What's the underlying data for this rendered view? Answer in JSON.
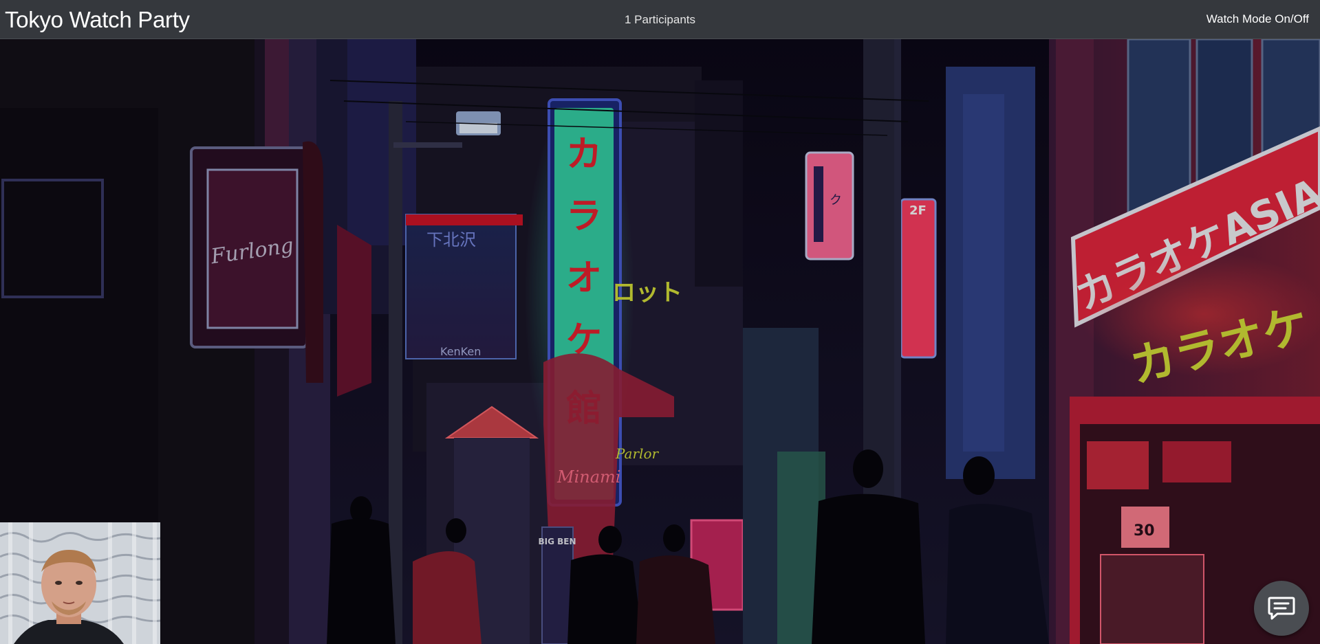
{
  "header": {
    "title": "Tokyo Watch Party",
    "participants": "1 Participants",
    "watch_mode_label": "Watch Mode On/Off"
  },
  "scene": {
    "vertical_sign": [
      "カ",
      "ラ",
      "オ",
      "ケ",
      "館"
    ],
    "right_sign_top": "カラオケASIA",
    "right_sign_bottom": "カラオケ",
    "pink_sign_left": "Furlong",
    "small_sign_text": "ロット",
    "parlor_text": "Parlor",
    "big_ben_text": "BIG BEN",
    "kenken_text": "KenKen"
  },
  "selfview": {
    "icon": "webcam-feed"
  },
  "chat": {
    "icon": "chat-bubble-icon"
  },
  "colors": {
    "topbar": "#35383d",
    "neon_green": "#3ee0b4",
    "neon_red": "#e8203d",
    "neon_pink": "#ff4f8b",
    "neon_yellow": "#d8e23a"
  }
}
